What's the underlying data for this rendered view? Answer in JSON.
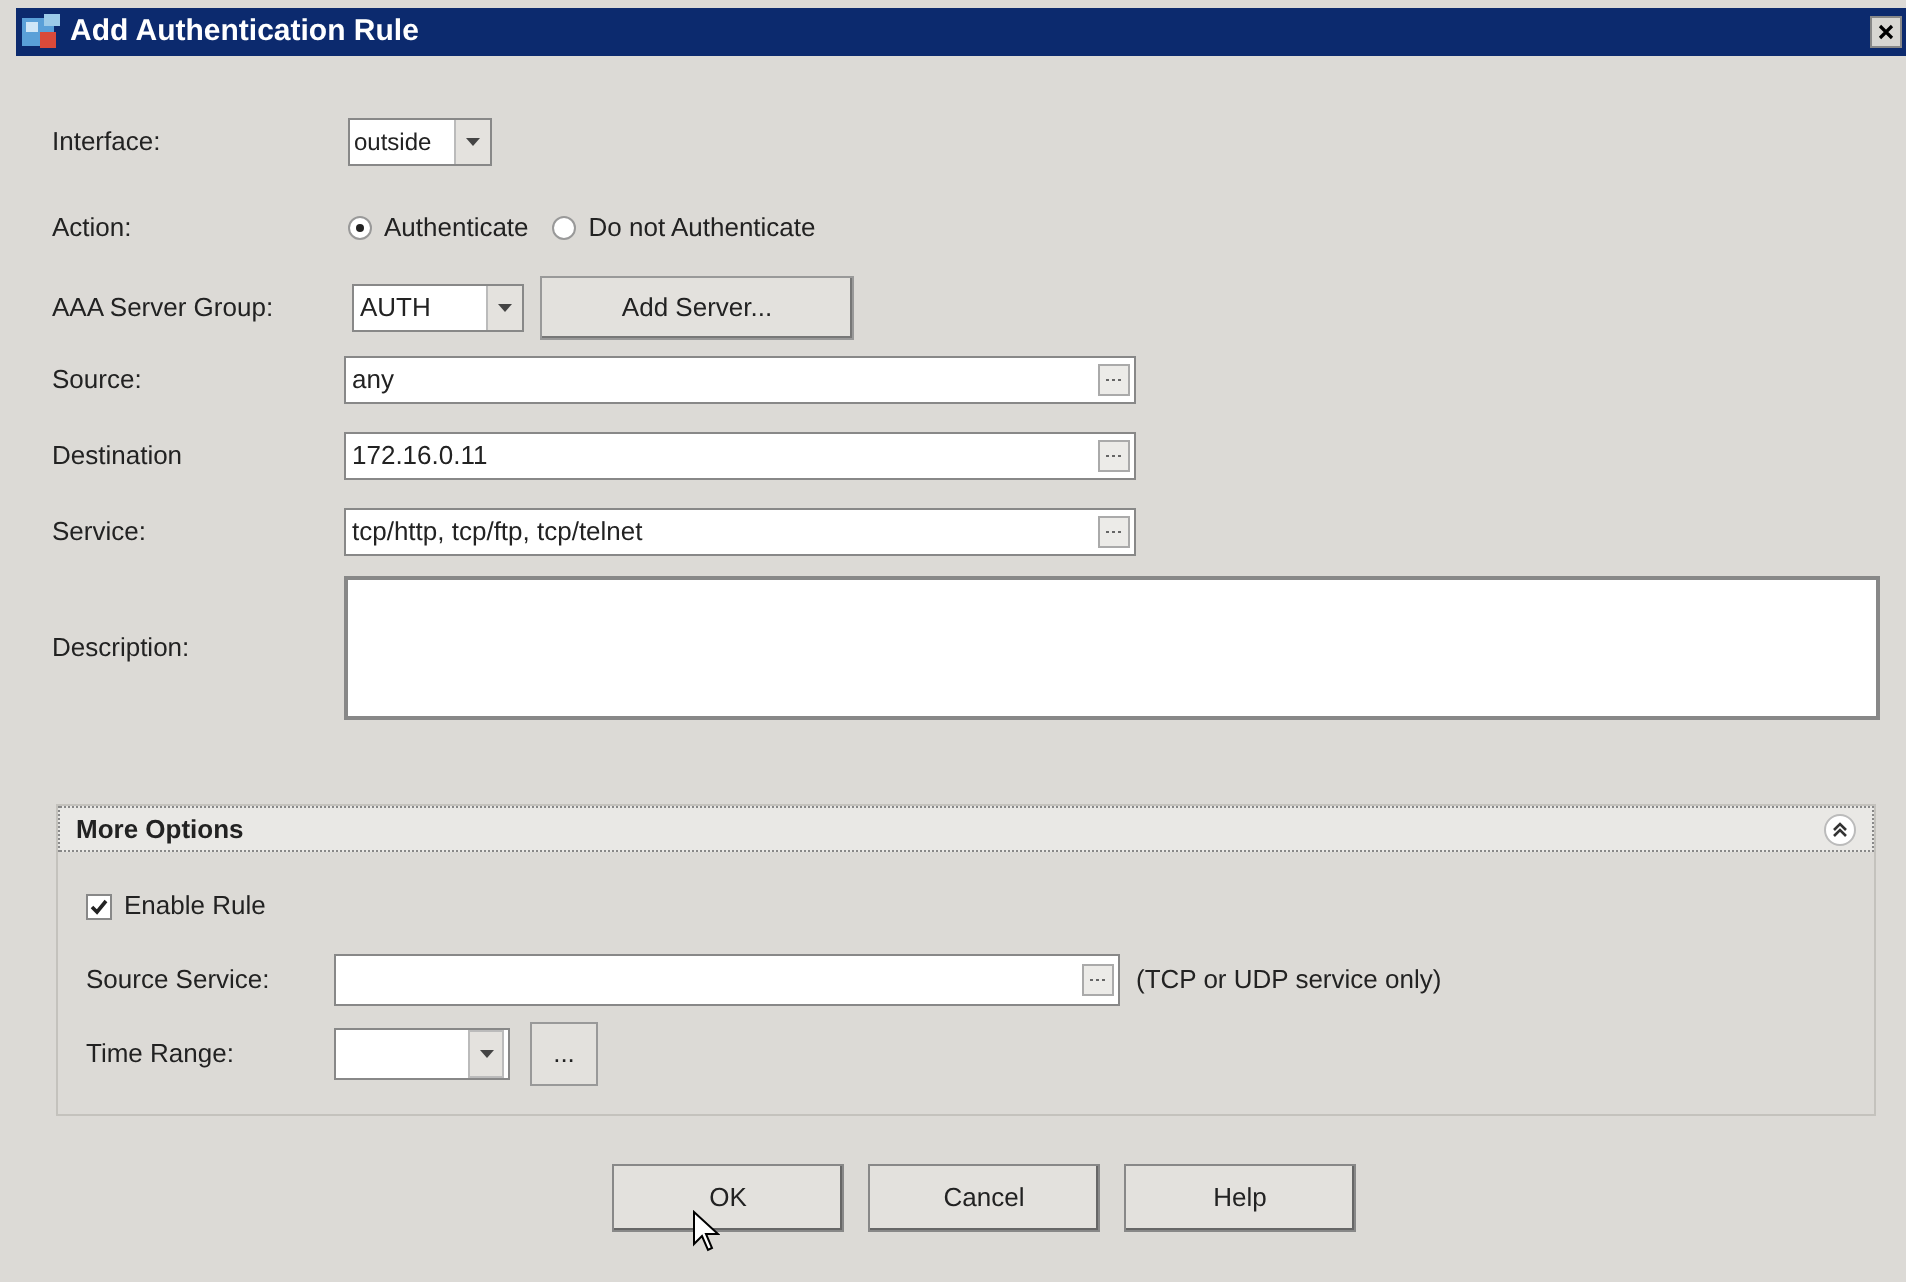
{
  "window": {
    "title": "Add Authentication Rule"
  },
  "interface": {
    "label": "Interface:",
    "value": "outside"
  },
  "action": {
    "label": "Action:",
    "options": [
      {
        "label": "Authenticate",
        "selected": true
      },
      {
        "label": "Do not Authenticate",
        "selected": false
      }
    ]
  },
  "aaa_server_group": {
    "label": "AAA Server Group:",
    "value": "AUTH",
    "button": "Add Server..."
  },
  "fields": [
    {
      "label": "Source:",
      "value": "any"
    },
    {
      "label": "Destination",
      "value": "172.16.0.11"
    },
    {
      "label": "Service:",
      "value": "tcp/http, tcp/ftp, tcp/telnet"
    }
  ],
  "description": {
    "label": "Description:"
  },
  "more_options": {
    "title": "More Options",
    "expanded": true,
    "enable_rule": {
      "label": "Enable Rule",
      "checked": true
    },
    "source_service": {
      "label": "Source Service:",
      "note": "(TCP or UDP service only)"
    },
    "time_range": {
      "label": "Time Range:",
      "button": "..."
    }
  },
  "buttons": [
    "OK",
    "Cancel",
    "Help"
  ]
}
